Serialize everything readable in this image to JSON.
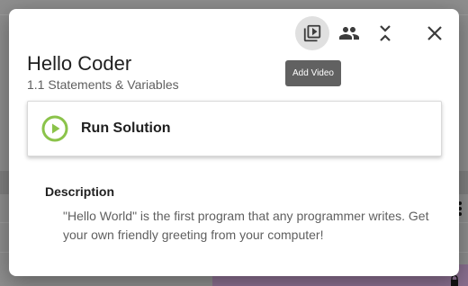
{
  "modal": {
    "title": "Hello Coder",
    "subtitle": "1.1 Statements & Variables",
    "run_label": "Run Solution",
    "description_heading": "Description",
    "description_text": "\"Hello World\" is the first program that any programmer writes. Get your own friendly greeting from your computer!"
  },
  "toolbar": {
    "icons": [
      "video-library-icon",
      "people-icon",
      "collapse-icon",
      "close-icon"
    ],
    "tooltip": "Add Video"
  },
  "colors": {
    "accent_green": "#8bc34a",
    "tooltip_bg": "#616161"
  }
}
